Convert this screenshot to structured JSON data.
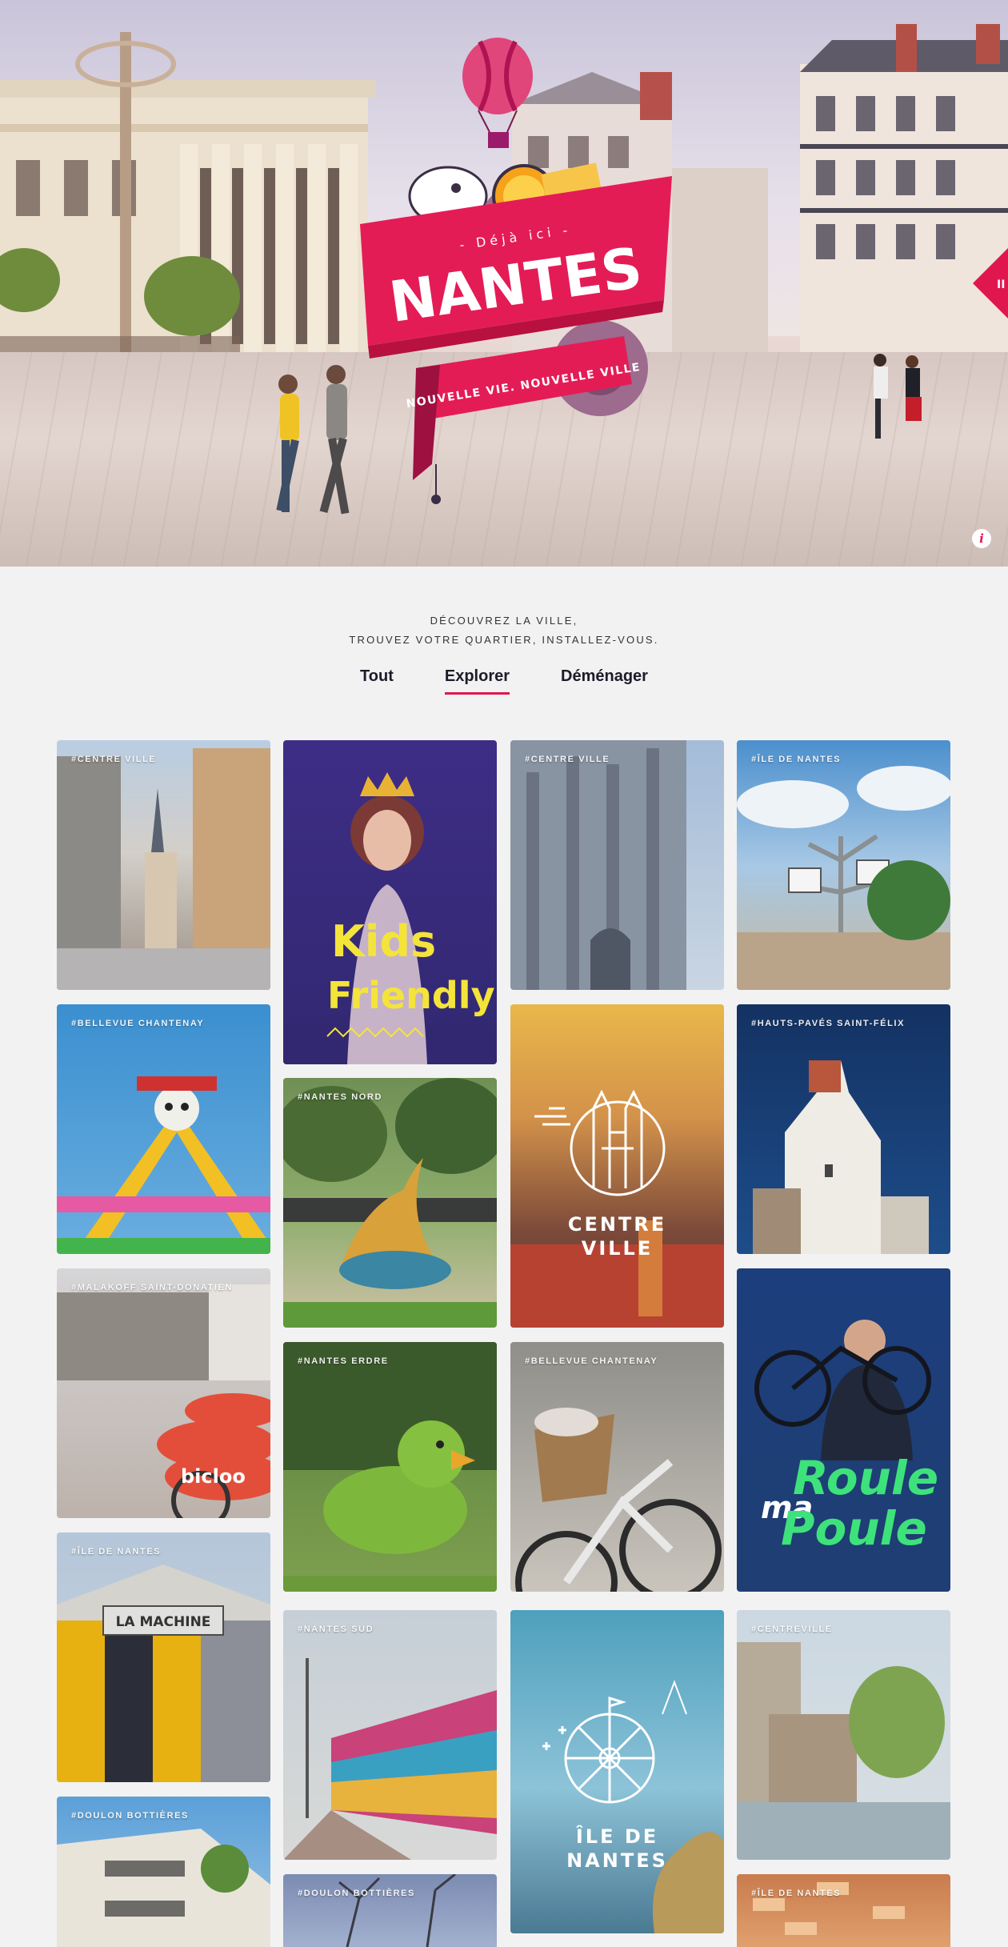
{
  "hero": {
    "badge_prefix": "- Déjà ici -",
    "badge_title": "NANTES",
    "badge_ribbon": "NOUVELLE VIE. NOUVELLE VILLE",
    "info_label": "i",
    "pause_label": "II"
  },
  "intro": {
    "line1": "DÉCOUVREZ LA VILLE,",
    "line2": "TROUVEZ VOTRE QUARTIER, INSTALLEZ-VOUS."
  },
  "tabs": [
    {
      "label": "Tout"
    },
    {
      "label": "Explorer",
      "active": true
    },
    {
      "label": "Déménager"
    }
  ],
  "cards": {
    "c1": {
      "tag": "#CENTRE VILLE"
    },
    "c2": {
      "tag": "",
      "title_line1": "Kids",
      "title_line2": "Friendly"
    },
    "c3": {
      "tag": "#CENTRE VILLE"
    },
    "c4": {
      "tag": "#ÎLE DE NANTES"
    },
    "c5": {
      "tag": "#BELLEVUE CHANTENAY"
    },
    "c6": {
      "tag": "#NANTES NORD"
    },
    "c7": {
      "tag": "",
      "title_line1": "CENTRE",
      "title_line2": "VILLE"
    },
    "c8": {
      "tag": "#HAUTS-PAVÉS SAINT-FÉLIX"
    },
    "c9": {
      "tag": "#MALAKOFF SAINT-DONATIEN",
      "bike_brand": "bicloo"
    },
    "c10": {
      "tag": "#NANTES ERDRE"
    },
    "c11": {
      "tag": "#BELLEVUE CHANTENAY"
    },
    "c12": {
      "tag": "",
      "title_line1": "Roule",
      "title_line2": "ma",
      "title_line3": "Poule"
    },
    "c13": {
      "tag": "#ÎLE DE NANTES",
      "sign": "LA MACHINE"
    },
    "c14": {
      "tag": "#NANTES SUD"
    },
    "c15": {
      "tag": "",
      "title_line1": "ÎLE DE",
      "title_line2": "NANTES"
    },
    "c16": {
      "tag": "#CENTREVILLE"
    },
    "c17": {
      "tag": "#DOULON BOTTIÈRES"
    },
    "c18": {
      "tag": "#DOULON BOTTIÈRES"
    },
    "c19": {
      "tag": "#ÎLE DE NANTES"
    }
  },
  "colors": {
    "accent": "#e0164f",
    "background": "#f2f2f2"
  }
}
